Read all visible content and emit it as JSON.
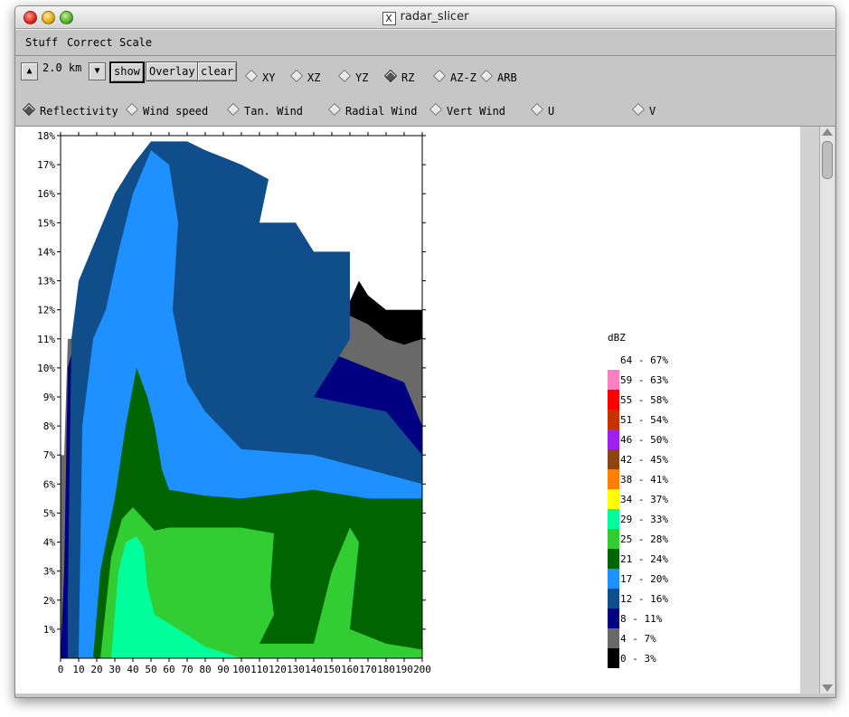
{
  "window": {
    "title": "radar_slicer",
    "title_icon": "X"
  },
  "menu": [
    "Stuff",
    "Correct",
    "Scale"
  ],
  "toolbar": {
    "up_arrow_icon": "up-arrow-icon",
    "km_value": "2.0 km",
    "down_arrow_icon": "down-arrow-icon",
    "show_label": "show",
    "overlay_label": "Overlay",
    "clear_label": "clear",
    "planes": [
      {
        "label": "XY",
        "selected": false
      },
      {
        "label": "XZ",
        "selected": false
      },
      {
        "label": "YZ",
        "selected": false
      },
      {
        "label": "RZ",
        "selected": true
      },
      {
        "label": "AZ-Z",
        "selected": false
      },
      {
        "label": "ARB",
        "selected": false
      }
    ],
    "fields": [
      {
        "label": "Reflectivity",
        "selected": true
      },
      {
        "label": "Wind speed",
        "selected": false
      },
      {
        "label": "Tan. Wind",
        "selected": false
      },
      {
        "label": "Radial Wind",
        "selected": false
      },
      {
        "label": "Vert Wind",
        "selected": false
      },
      {
        "label": "U",
        "selected": false
      },
      {
        "label": "V",
        "selected": false
      }
    ]
  },
  "chart_data": {
    "type": "heatmap",
    "title": "",
    "xlabel": "",
    "ylabel": "",
    "xlim": [
      0,
      200
    ],
    "ylim": [
      0,
      18
    ],
    "x_ticks": [
      "0",
      "10",
      "20",
      "30",
      "40",
      "50",
      "60",
      "70",
      "80",
      "90",
      "100",
      "110",
      "120",
      "130",
      "140",
      "150",
      "160",
      "170",
      "180",
      "190",
      "200"
    ],
    "y_ticks": [
      "1%",
      "2%",
      "3%",
      "4%",
      "5%",
      "6%",
      "7%",
      "8%",
      "9%",
      "10%",
      "11%",
      "12%",
      "13%",
      "14%",
      "15%",
      "16%",
      "17%",
      "18%"
    ],
    "colorbar": {
      "title": "dBZ",
      "bins": [
        {
          "label": "64 - 67%",
          "color": "#ffffff"
        },
        {
          "label": "59 - 63%",
          "color": "#ff80c0"
        },
        {
          "label": "55 - 58%",
          "color": "#ff0000"
        },
        {
          "label": "51 - 54%",
          "color": "#c83200"
        },
        {
          "label": "46 - 50%",
          "color": "#a020f0"
        },
        {
          "label": "42 - 45%",
          "color": "#8b4513"
        },
        {
          "label": "38 - 41%",
          "color": "#ff7f00"
        },
        {
          "label": "34 - 37%",
          "color": "#ffff00"
        },
        {
          "label": "29 - 33%",
          "color": "#00ff9a"
        },
        {
          "label": "25 - 28%",
          "color": "#32cd32"
        },
        {
          "label": "21 - 24%",
          "color": "#006400"
        },
        {
          "label": "17 - 20%",
          "color": "#1e90ff"
        },
        {
          "label": "12 - 16%",
          "color": "#104e8b"
        },
        {
          "label": "8 - 11%",
          "color": "#000080"
        },
        {
          "label": "4 - 7%",
          "color": "#696969"
        },
        {
          "label": "0 - 3%",
          "color": "#000000"
        }
      ]
    },
    "layers": [
      {
        "bin": "4 - 7%",
        "color": "#696969",
        "top": [
          [
            0,
            7
          ],
          [
            2,
            7
          ],
          [
            4,
            11
          ],
          [
            10,
            11
          ],
          [
            18,
            14
          ],
          [
            60,
            14
          ],
          [
            80,
            12
          ],
          [
            120,
            12.5
          ],
          [
            130,
            12
          ],
          [
            160,
            12
          ],
          [
            170,
            12
          ],
          [
            200,
            12
          ],
          [
            200,
            0
          ],
          [
            0,
            0
          ]
        ]
      },
      {
        "bin": "0 - 3%",
        "color": "#000000",
        "top": [
          [
            160,
            12.3
          ],
          [
            165,
            13
          ],
          [
            170,
            12.5
          ],
          [
            180,
            12
          ],
          [
            200,
            12
          ],
          [
            200,
            11
          ],
          [
            190,
            10.8
          ],
          [
            180,
            11
          ],
          [
            170,
            11.5
          ],
          [
            160,
            11.8
          ]
        ]
      },
      {
        "bin": "8 - 11%",
        "color": "#000080",
        "top": [
          [
            2,
            3
          ],
          [
            4,
            10
          ],
          [
            8,
            11
          ],
          [
            12,
            13
          ],
          [
            20,
            14
          ],
          [
            30,
            13
          ],
          [
            60,
            12
          ],
          [
            100,
            12
          ],
          [
            120,
            11
          ],
          [
            130,
            10
          ],
          [
            150,
            10.5
          ],
          [
            170,
            10
          ],
          [
            190,
            9.5
          ],
          [
            200,
            8
          ],
          [
            200,
            0
          ],
          [
            0,
            0
          ]
        ]
      },
      {
        "bin": "12 - 16%",
        "color": "#104e8b",
        "top": [
          [
            4,
            2
          ],
          [
            6,
            11
          ],
          [
            10,
            13
          ],
          [
            30,
            16
          ],
          [
            40,
            17
          ],
          [
            50,
            17.8
          ],
          [
            70,
            17.8
          ],
          [
            80,
            17.5
          ],
          [
            100,
            17
          ],
          [
            115,
            16.5
          ],
          [
            110,
            15
          ],
          [
            130,
            15
          ],
          [
            140,
            14
          ],
          [
            160,
            14
          ],
          [
            160,
            11
          ],
          [
            140,
            9
          ],
          [
            180,
            8.5
          ],
          [
            200,
            7
          ],
          [
            200,
            0
          ],
          [
            4,
            0
          ]
        ]
      },
      {
        "bin": "17 - 20%",
        "color": "#1e90ff",
        "top": [
          [
            10,
            0
          ],
          [
            12,
            8
          ],
          [
            18,
            11
          ],
          [
            25,
            12
          ],
          [
            32,
            14
          ],
          [
            40,
            16
          ],
          [
            50,
            17.5
          ],
          [
            60,
            17
          ],
          [
            65,
            15
          ],
          [
            62,
            12
          ],
          [
            70,
            9.5
          ],
          [
            80,
            8.5
          ],
          [
            100,
            7.2
          ],
          [
            140,
            7
          ],
          [
            170,
            6.5
          ],
          [
            200,
            6
          ],
          [
            200,
            0
          ],
          [
            10,
            0
          ]
        ]
      },
      {
        "bin": "21 - 24%",
        "color": "#006400",
        "top": [
          [
            18,
            0
          ],
          [
            22,
            3
          ],
          [
            30,
            5.5
          ],
          [
            36,
            8
          ],
          [
            42,
            10
          ],
          [
            48,
            9
          ],
          [
            52,
            8
          ],
          [
            56,
            6.5
          ],
          [
            60,
            5.8
          ],
          [
            80,
            5.6
          ],
          [
            100,
            5.5
          ],
          [
            140,
            5.8
          ],
          [
            170,
            5.5
          ],
          [
            200,
            5.5
          ],
          [
            200,
            0
          ],
          [
            18,
            0
          ]
        ]
      },
      {
        "bin": "25 - 28%",
        "color": "#32cd32",
        "top": [
          [
            22,
            0
          ],
          [
            28,
            3.5
          ],
          [
            34,
            4.8
          ],
          [
            40,
            5.2
          ],
          [
            46,
            4.8
          ],
          [
            52,
            4.4
          ],
          [
            60,
            4.5
          ],
          [
            80,
            4.5
          ],
          [
            100,
            4.5
          ],
          [
            118,
            4.3
          ],
          [
            116,
            2.5
          ],
          [
            118,
            1.5
          ],
          [
            110,
            0.5
          ],
          [
            140,
            0.5
          ],
          [
            150,
            3
          ],
          [
            160,
            4.5
          ],
          [
            165,
            4
          ],
          [
            160,
            1
          ],
          [
            180,
            0.5
          ],
          [
            200,
            0.3
          ],
          [
            200,
            0
          ],
          [
            22,
            0
          ]
        ]
      },
      {
        "bin": "29 - 33%",
        "color": "#00ff9a",
        "top": [
          [
            28,
            0
          ],
          [
            32,
            3
          ],
          [
            36,
            4
          ],
          [
            42,
            4.2
          ],
          [
            46,
            3.8
          ],
          [
            48,
            2.5
          ],
          [
            52,
            1.5
          ],
          [
            60,
            1.2
          ],
          [
            70,
            0.8
          ],
          [
            80,
            0.4
          ],
          [
            90,
            0.2
          ],
          [
            100,
            0
          ],
          [
            28,
            0
          ]
        ]
      }
    ]
  }
}
